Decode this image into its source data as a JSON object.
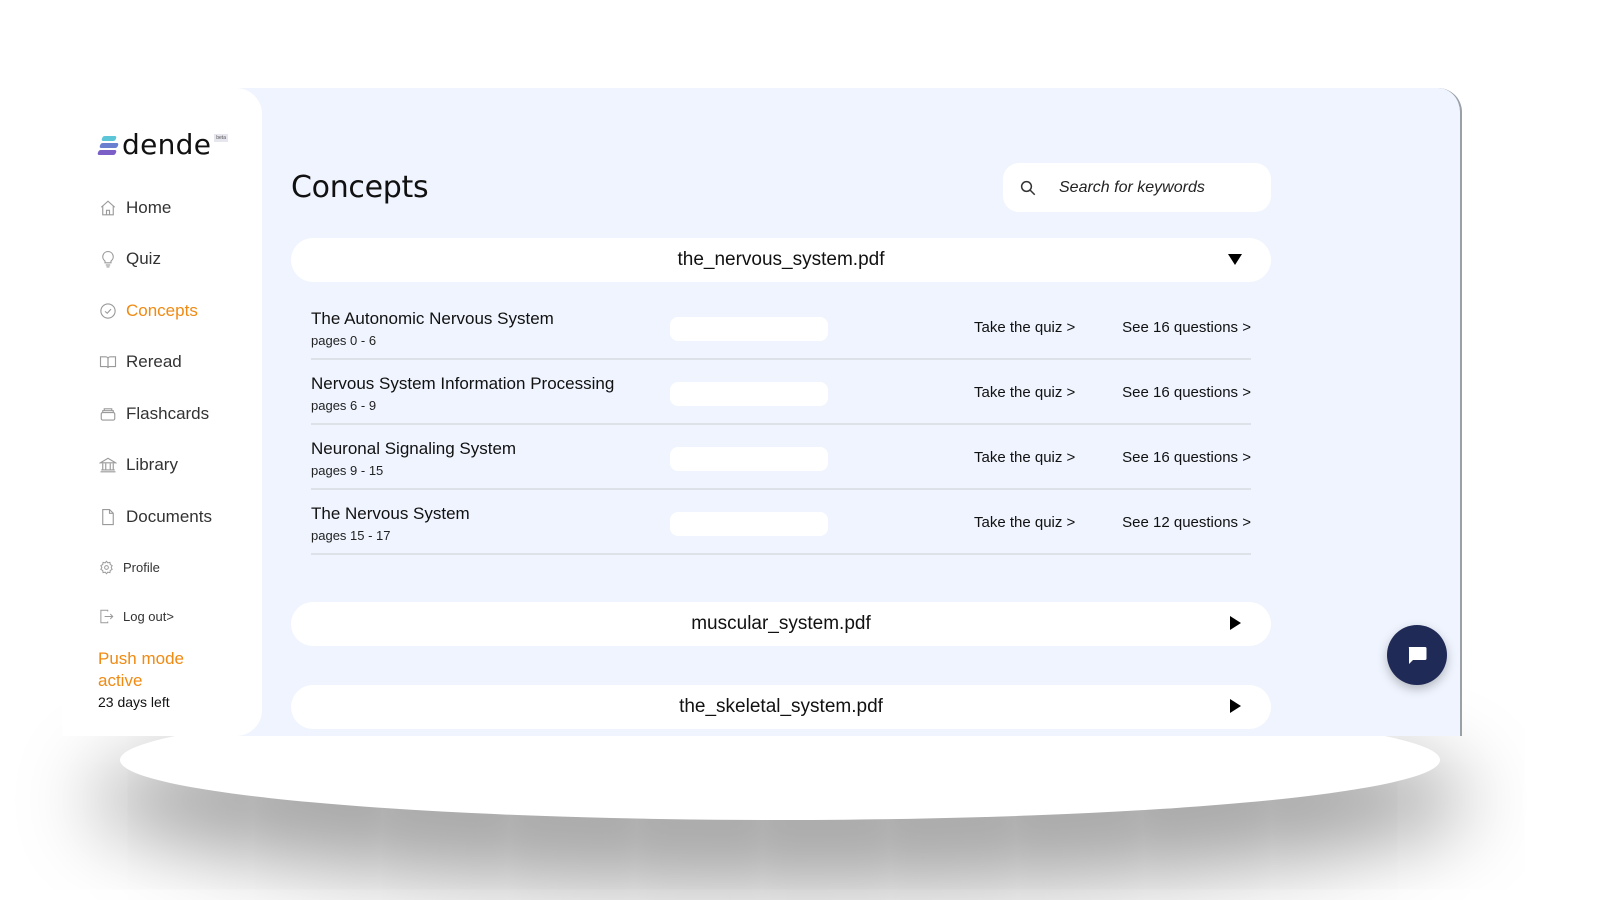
{
  "brand": {
    "name": "dende",
    "badge": "beta"
  },
  "sidebar": {
    "items": [
      {
        "label": "Home",
        "icon": "home-icon"
      },
      {
        "label": "Quiz",
        "icon": "lightbulb-icon"
      },
      {
        "label": "Concepts",
        "icon": "check-circle-icon",
        "active": true
      },
      {
        "label": "Reread",
        "icon": "book-open-icon"
      },
      {
        "label": "Flashcards",
        "icon": "card-stack-icon"
      },
      {
        "label": "Library",
        "icon": "library-icon"
      },
      {
        "label": "Documents",
        "icon": "document-icon"
      }
    ],
    "secondary": [
      {
        "label": "Profile",
        "icon": "gear-icon"
      },
      {
        "label": "Log out>",
        "icon": "logout-icon"
      }
    ],
    "push_mode": {
      "title": "Push mode active",
      "days_left": "23 days left"
    }
  },
  "main": {
    "title": "Concepts",
    "search": {
      "placeholder": "Search for keywords",
      "value": ""
    },
    "documents": [
      {
        "name": "the_nervous_system.pdf",
        "expanded": true,
        "concepts": [
          {
            "title": "The Autonomic Nervous System",
            "pages": "pages 0 - 6",
            "progress": 0,
            "quiz_label": "Take the quiz >",
            "questions_label": "See 16 questions >"
          },
          {
            "title": "Nervous System Information Processing",
            "pages": "pages 6 - 9",
            "progress": 0,
            "quiz_label": "Take the quiz >",
            "questions_label": "See 16 questions >"
          },
          {
            "title": "Neuronal Signaling System",
            "pages": "pages 9 - 15",
            "progress": 0,
            "quiz_label": "Take the quiz >",
            "questions_label": "See 16 questions >"
          },
          {
            "title": "The Nervous System",
            "pages": "pages 15 - 17",
            "progress": 0,
            "quiz_label": "Take the quiz >",
            "questions_label": "See 12 questions >"
          }
        ]
      },
      {
        "name": "muscular_system.pdf",
        "expanded": false
      },
      {
        "name": "the_skeletal_system.pdf",
        "expanded": false
      }
    ]
  },
  "chat": {
    "icon": "chat-bubble-icon"
  },
  "colors": {
    "accent": "#f08a12",
    "background": "#eff4fe",
    "chat_button": "#1f2a56"
  }
}
